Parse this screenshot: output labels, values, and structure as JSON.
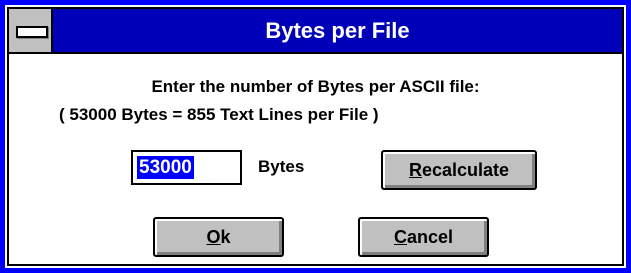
{
  "window": {
    "title": "Bytes per File"
  },
  "message": {
    "line1": "Enter the number of Bytes per ASCII file:",
    "line2": "( 53000 Bytes = 855 Text Lines per File )"
  },
  "bytes_field": {
    "value": "53000",
    "unit_label": "Bytes"
  },
  "buttons": {
    "recalculate": {
      "mnemonic": "R",
      "rest": "ecalculate"
    },
    "ok": {
      "mnemonic": "O",
      "rest": "k"
    },
    "cancel": {
      "mnemonic": "C",
      "rest": "ancel"
    }
  },
  "colors": {
    "window_frame": "#0000ff",
    "titlebar": "#0000b8",
    "button_face": "#c0c0c0",
    "selection": "#0000ff"
  },
  "icons": {
    "system_menu": "system-menu-icon"
  }
}
